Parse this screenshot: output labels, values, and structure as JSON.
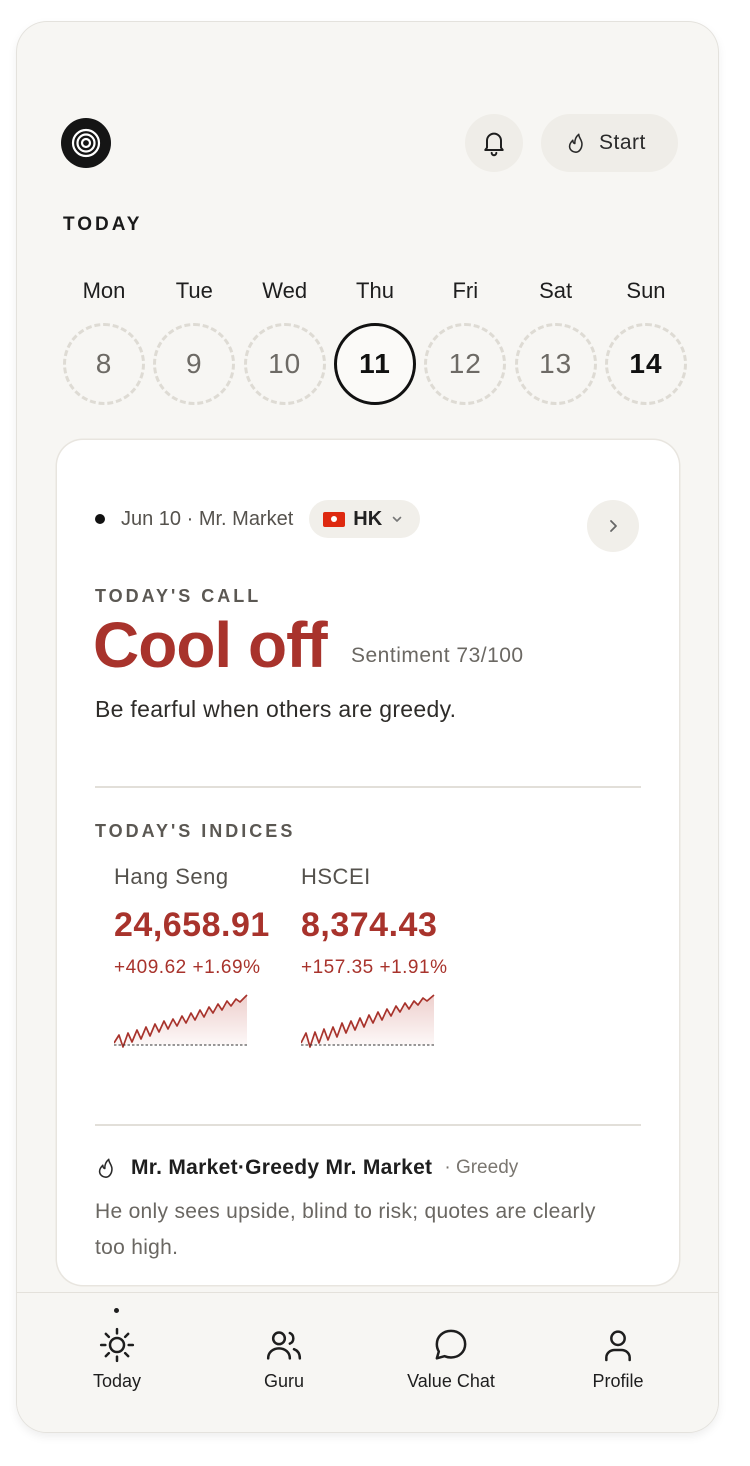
{
  "header": {
    "logo_icon": "spiral-logo-icon",
    "notifications_icon": "bell-icon",
    "start_button": {
      "icon": "flame-icon",
      "label": "Start"
    }
  },
  "today_label": "TODAY",
  "week": {
    "selected_index": 3,
    "days": [
      {
        "name": "Mon",
        "date": "8"
      },
      {
        "name": "Tue",
        "date": "9"
      },
      {
        "name": "Wed",
        "date": "10"
      },
      {
        "name": "Thu",
        "date": "11"
      },
      {
        "name": "Fri",
        "date": "12"
      },
      {
        "name": "Sat",
        "date": "13"
      },
      {
        "name": "Sun",
        "date": "14"
      }
    ]
  },
  "card": {
    "meta": "Jun 10 · Mr. Market",
    "market": {
      "flag_icon": "hong-kong-flag-icon",
      "code": "HK",
      "chevron_icon": "chevron-down-icon"
    },
    "next_icon": "chevron-right-icon",
    "call_label": "TODAY'S CALL",
    "call_title": "Cool off",
    "sentiment": "Sentiment 73/100",
    "quote": "Be fearful when others are greedy.",
    "indices_label": "TODAY'S INDICES",
    "indices": [
      {
        "name": "Hang Seng",
        "value": "24,658.91",
        "change": "+409.62 +1.69%"
      },
      {
        "name": "HSCEI",
        "value": "8,374.43",
        "change": "+157.35 +1.91%"
      }
    ],
    "persona": {
      "icon": "flame-icon",
      "name": "Mr. Market·Greedy Mr. Market",
      "tag": "· Greedy",
      "description": "He only sees upside, blind to risk; quotes are clearly too high."
    }
  },
  "nav": {
    "active_index": 0,
    "items": [
      {
        "icon": "sun-icon",
        "label": "Today"
      },
      {
        "icon": "users-icon",
        "label": "Guru"
      },
      {
        "icon": "chat-bubble-icon",
        "label": "Value Chat"
      },
      {
        "icon": "user-icon",
        "label": "Profile"
      }
    ]
  },
  "colors": {
    "accent_red": "#a8332c",
    "background": "#f7f6f3",
    "card": "#ffffff"
  }
}
